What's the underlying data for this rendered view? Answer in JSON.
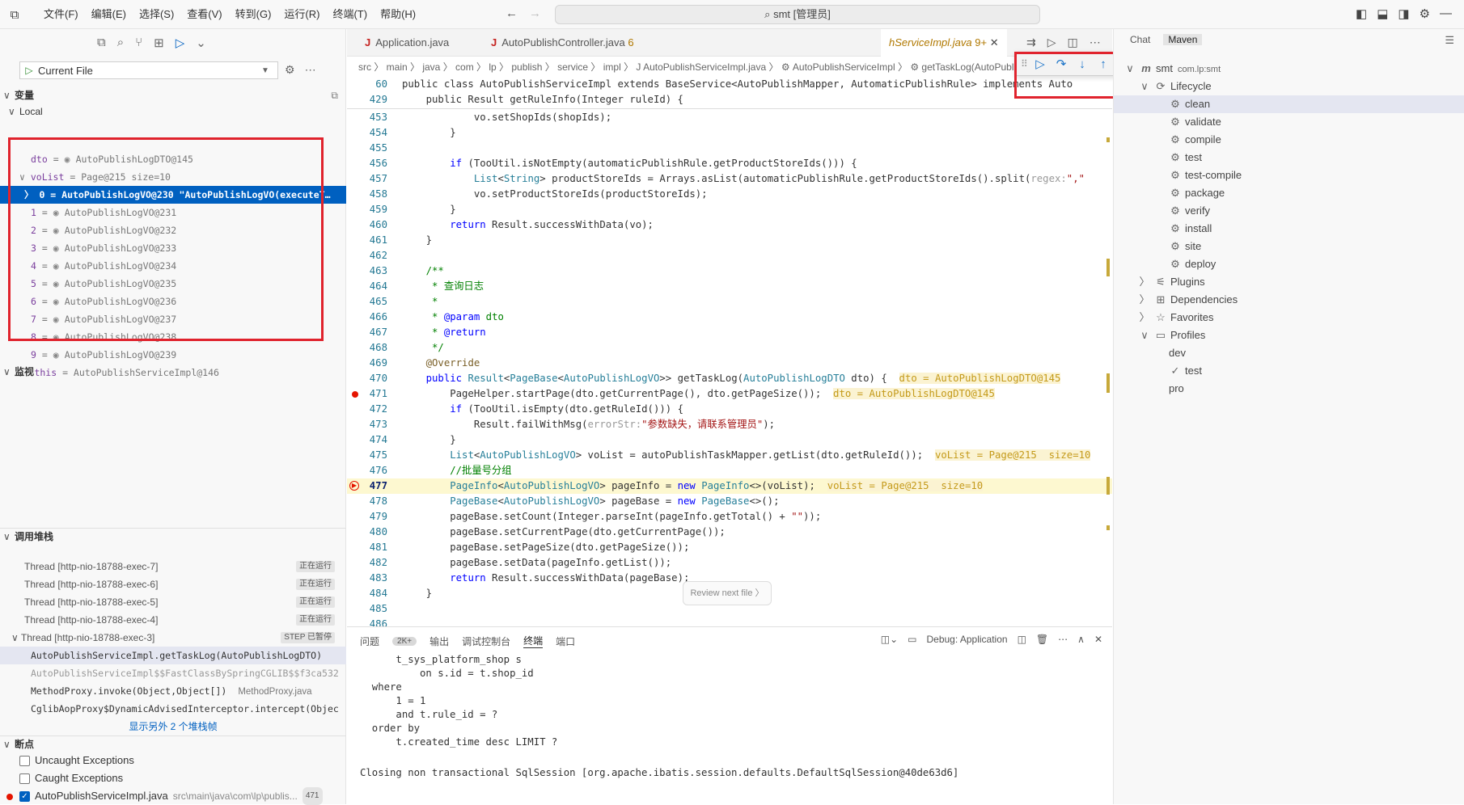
{
  "titlebar": {
    "menus": [
      "文件(F)",
      "编辑(E)",
      "选择(S)",
      "查看(V)",
      "转到(G)",
      "运行(R)",
      "终端(T)",
      "帮助(H)"
    ],
    "search": "smt [管理员]"
  },
  "left": {
    "run_config": "Current File",
    "variables_title": "变量",
    "local_label": "Local",
    "vars": [
      {
        "key": "dto",
        "val": "AutoPublishLogDTO@145",
        "eye": true
      },
      {
        "key": "voList",
        "val": "Page@215  size=10",
        "expanded": true
      },
      {
        "key": "0",
        "val": "AutoPublishLogVO@230 \"AutoPublishLogVO(executeT…",
        "selected": true
      },
      {
        "key": "1",
        "val": "AutoPublishLogVO@231",
        "eye": true
      },
      {
        "key": "2",
        "val": "AutoPublishLogVO@232",
        "eye": true
      },
      {
        "key": "3",
        "val": "AutoPublishLogVO@233",
        "eye": true
      },
      {
        "key": "4",
        "val": "AutoPublishLogVO@234",
        "eye": true
      },
      {
        "key": "5",
        "val": "AutoPublishLogVO@235",
        "eye": true
      },
      {
        "key": "6",
        "val": "AutoPublishLogVO@236",
        "eye": true
      },
      {
        "key": "7",
        "val": "AutoPublishLogVO@237",
        "eye": true
      },
      {
        "key": "8",
        "val": "AutoPublishLogVO@238",
        "eye": true
      },
      {
        "key": "9",
        "val": "AutoPublishLogVO@239",
        "eye": true
      },
      {
        "key": "this",
        "val": "AutoPublishServiceImpl@146"
      }
    ],
    "watch_title": "监视",
    "callstack_title": "调用堆栈",
    "threads": [
      {
        "name": "Thread [http-nio-18788-exec-7]",
        "badge": "正在运行"
      },
      {
        "name": "Thread [http-nio-18788-exec-6]",
        "badge": "正在运行"
      },
      {
        "name": "Thread [http-nio-18788-exec-5]",
        "badge": "正在运行"
      },
      {
        "name": "Thread [http-nio-18788-exec-4]",
        "badge": "正在运行"
      },
      {
        "name": "Thread [http-nio-18788-exec-3]",
        "badge": "STEP 已暂停"
      }
    ],
    "frames": [
      {
        "name": "AutoPublishServiceImpl.getTaskLog(AutoPublishLogDTO)",
        "file": ""
      },
      {
        "name": "AutoPublishServiceImpl$$FastClassBySpringCGLIB$$f3ca532",
        "file": ""
      },
      {
        "name": "MethodProxy.invoke(Object,Object[])",
        "file": "MethodProxy.java"
      },
      {
        "name": "CglibAopProxy$DynamicAdvisedInterceptor.intercept(Objec",
        "file": ""
      }
    ],
    "more_frames": "显示另外 2 个堆栈帧",
    "breakpoints_title": "断点",
    "breakpoints": [
      {
        "label": "Uncaught Exceptions",
        "checked": false
      },
      {
        "label": "Caught Exceptions",
        "checked": false
      },
      {
        "label": "AutoPublishServiceImpl.java",
        "path": "src\\main\\java\\com\\lp\\publis...",
        "count": "471",
        "checked": true
      }
    ]
  },
  "editor": {
    "tabs": [
      {
        "label": "Application.java"
      },
      {
        "label": "AutoPublishController.java",
        "count": "6"
      },
      {
        "label": "hServiceImpl.java",
        "count": "9+",
        "active": true
      }
    ],
    "breadcrumb": "src 〉 main 〉 java 〉 com 〉 lp 〉 publish 〉 service 〉 impl 〉 J AutoPublishServiceImpl.java 〉 ⚙ AutoPublishServiceImpl 〉 ⚙ getTaskLog(AutoPublishLogDTO)",
    "sticky": [
      {
        "ln": "60",
        "text": "public class AutoPublishServiceImpl extends BaseService<AutoPublishMapper, AutomaticPublishRule> implements Auto"
      },
      {
        "ln": "429",
        "text": "    public Result getRuleInfo(Integer ruleId) {"
      }
    ],
    "review": "Review next file 〉"
  },
  "bottom": {
    "tabs": [
      "问题",
      "2K+",
      "输出",
      "调试控制台",
      "终端",
      "端口"
    ],
    "active": "终端",
    "session": "Debug: Application",
    "lines": [
      "      t_sys_platform_shop s",
      "          on s.id = t.shop_id",
      "  where",
      "      1 = 1",
      "      and t.rule_id = ?",
      "  order by",
      "      t.created_time desc LIMIT ?",
      "",
      "Closing non transactional SqlSession [org.apache.ibatis.session.defaults.DefaultSqlSession@40de63d6]"
    ]
  },
  "right": {
    "tabs": [
      "Chat",
      "Maven"
    ],
    "active": "Maven",
    "tree": [
      {
        "label": "smt",
        "sub": "com.lp:smt",
        "indent": 0,
        "icon": "m",
        "tw": "∨"
      },
      {
        "label": "Lifecycle",
        "indent": 1,
        "icon": "⟳",
        "tw": "∨"
      },
      {
        "label": "clean",
        "indent": 2,
        "icon": "⚙",
        "selected": true
      },
      {
        "label": "validate",
        "indent": 2,
        "icon": "⚙"
      },
      {
        "label": "compile",
        "indent": 2,
        "icon": "⚙"
      },
      {
        "label": "test",
        "indent": 2,
        "icon": "⚙"
      },
      {
        "label": "test-compile",
        "indent": 2,
        "icon": "⚙"
      },
      {
        "label": "package",
        "indent": 2,
        "icon": "⚙"
      },
      {
        "label": "verify",
        "indent": 2,
        "icon": "⚙"
      },
      {
        "label": "install",
        "indent": 2,
        "icon": "⚙"
      },
      {
        "label": "site",
        "indent": 2,
        "icon": "⚙"
      },
      {
        "label": "deploy",
        "indent": 2,
        "icon": "⚙"
      },
      {
        "label": "Plugins",
        "indent": 1,
        "icon": "⚟",
        "tw": "〉"
      },
      {
        "label": "Dependencies",
        "indent": 1,
        "icon": "⊞",
        "tw": "〉"
      },
      {
        "label": "Favorites",
        "indent": 1,
        "icon": "☆",
        "tw": "〉"
      },
      {
        "label": "Profiles",
        "indent": 1,
        "icon": "▭",
        "tw": "∨"
      },
      {
        "label": "dev",
        "indent": 2,
        "icon": ""
      },
      {
        "label": "test",
        "indent": 2,
        "icon": "✓"
      },
      {
        "label": "pro",
        "indent": 2,
        "icon": ""
      }
    ]
  }
}
